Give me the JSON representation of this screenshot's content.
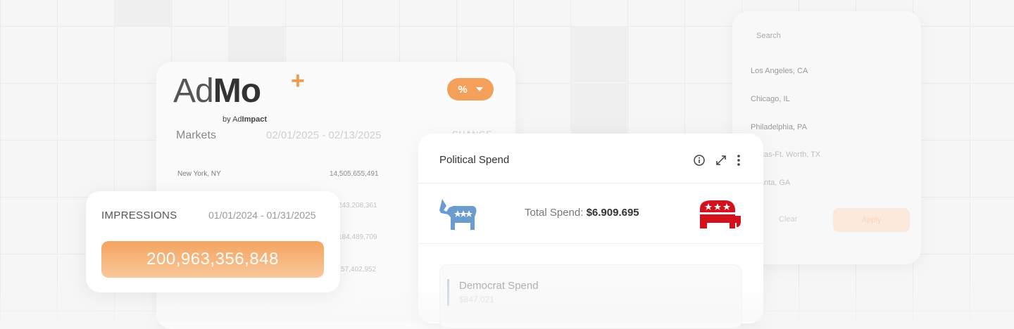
{
  "logo": {
    "ad": "Ad",
    "mo": "Mo",
    "plus": "+",
    "by": "by Ad",
    "by_bold": "Impact"
  },
  "markets": {
    "unit_button": "%",
    "title": "Markets",
    "date_range": "02/01/2025 - 02/13/2025",
    "change_header": "CHANGE",
    "rows": [
      {
        "market": "New York, NY",
        "value": "14,505,655,491"
      },
      {
        "market": "",
        "value": "243,208,361"
      },
      {
        "market": "",
        "value": "184,489,709"
      },
      {
        "market": "",
        "value": "57,402,952"
      }
    ]
  },
  "filter": {
    "search_placeholder": "Search",
    "locations": [
      "Los Angeles, CA",
      "Chicago, IL",
      "Philadelphia, PA",
      "Dallas-Ft. Worth, TX",
      "Atlanta, GA"
    ],
    "clear_label": "Clear",
    "apply_label": "Apply"
  },
  "political_spend": {
    "title": "Political Spend",
    "total_label": "Total Spend:",
    "total_value": "$6.909.695",
    "democrat_label": "Democrat Spend",
    "democrat_value": "$847,021",
    "colors": {
      "democrat": "#6a9ccf",
      "republican": "#d4121d"
    }
  },
  "impressions": {
    "title": "IMPRESSIONS",
    "date_range": "01/01/2024 - 01/31/2025",
    "value": "200,963,356,848"
  },
  "colors": {
    "accent": "#f4a05a"
  }
}
